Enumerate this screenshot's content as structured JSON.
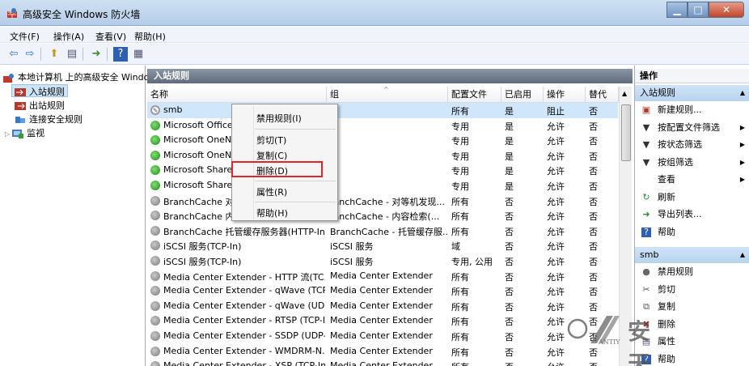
{
  "window": {
    "title": "高级安全 Windows 防火墙"
  },
  "menu": [
    "文件(F)",
    "操作(A)",
    "查看(V)",
    "帮助(H)"
  ],
  "tree": {
    "root": "本地计算机 上的高级安全 Windo",
    "items": [
      "入站规则",
      "出站规则",
      "连接安全规则",
      "监视"
    ]
  },
  "center": {
    "title": "入站规则",
    "columns": [
      "名称",
      "组",
      "配置文件",
      "已启用",
      "操作",
      "替代"
    ],
    "rows": [
      {
        "icon": "block",
        "name": "smb",
        "group": "",
        "profile": "所有",
        "enabled": "是",
        "action": "阻止",
        "override": "否"
      },
      {
        "icon": "green",
        "name": "Microsoft Office",
        "group": "",
        "profile": "专用",
        "enabled": "是",
        "action": "允许",
        "override": "否"
      },
      {
        "icon": "green",
        "name": "Microsoft OneN",
        "group": "",
        "profile": "专用",
        "enabled": "是",
        "action": "允许",
        "override": "否"
      },
      {
        "icon": "green",
        "name": "Microsoft OneN",
        "group": "",
        "profile": "专用",
        "enabled": "是",
        "action": "允许",
        "override": "否"
      },
      {
        "icon": "green",
        "name": "Microsoft Share",
        "group": "",
        "profile": "专用",
        "enabled": "是",
        "action": "允许",
        "override": "否"
      },
      {
        "icon": "green",
        "name": "Microsoft Share",
        "group": "",
        "profile": "专用",
        "enabled": "是",
        "action": "允许",
        "override": "否"
      },
      {
        "icon": "gray",
        "name": "BranchCache 对等",
        "group": "ranchCache - 对等机发现...",
        "profile": "所有",
        "enabled": "否",
        "action": "允许",
        "override": "否"
      },
      {
        "icon": "gray",
        "name": "BranchCache 内容",
        "group": "ranchCache - 内容检索(...",
        "profile": "所有",
        "enabled": "否",
        "action": "允许",
        "override": "否"
      },
      {
        "icon": "gray",
        "name": "BranchCache 托管缓存服务器(HTTP-In)",
        "group": "BranchCache - 托管缓存服...",
        "profile": "所有",
        "enabled": "否",
        "action": "允许",
        "override": "否"
      },
      {
        "icon": "gray",
        "name": "iSCSI 服务(TCP-In)",
        "group": "iSCSI 服务",
        "profile": "域",
        "enabled": "否",
        "action": "允许",
        "override": "否"
      },
      {
        "icon": "gray",
        "name": "iSCSI 服务(TCP-In)",
        "group": "iSCSI 服务",
        "profile": "专用, 公用",
        "enabled": "否",
        "action": "允许",
        "override": "否"
      },
      {
        "icon": "gray",
        "name": "Media Center Extender - HTTP 流(TC...",
        "group": "Media Center Extender",
        "profile": "所有",
        "enabled": "否",
        "action": "允许",
        "override": "否"
      },
      {
        "icon": "gray",
        "name": "Media Center Extender - qWave (TCP...",
        "group": "Media Center Extender",
        "profile": "所有",
        "enabled": "否",
        "action": "允许",
        "override": "否"
      },
      {
        "icon": "gray",
        "name": "Media Center Extender - qWave (UD...",
        "group": "Media Center Extender",
        "profile": "所有",
        "enabled": "否",
        "action": "允许",
        "override": "否"
      },
      {
        "icon": "gray",
        "name": "Media Center Extender - RTSP (TCP-In)",
        "group": "Media Center Extender",
        "profile": "所有",
        "enabled": "否",
        "action": "允许",
        "override": "否"
      },
      {
        "icon": "gray",
        "name": "Media Center Extender - SSDP (UDP-...",
        "group": "Media Center Extender",
        "profile": "所有",
        "enabled": "否",
        "action": "允许",
        "override": "否"
      },
      {
        "icon": "gray",
        "name": "Media Center Extender - WMDRM-N...",
        "group": "Media Center Extender",
        "profile": "所有",
        "enabled": "否",
        "action": "允许",
        "override": "否"
      },
      {
        "icon": "gray",
        "name": "Media Center Extender - XSP (TCP-In)",
        "group": "Media Center Extender",
        "profile": "所有",
        "enabled": "否",
        "action": "允许",
        "override": "否"
      }
    ]
  },
  "context_menu": {
    "items": [
      "禁用规则(I)",
      "剪切(T)",
      "复制(C)",
      "删除(D)",
      "属性(R)",
      "帮助(H)"
    ],
    "highlighted": "删除(D)"
  },
  "actions": {
    "title": "操作",
    "section1": "入站规则",
    "section1_items": [
      {
        "icon": "new-rule-icon",
        "label": "新建规则..."
      },
      {
        "icon": "filter-icon",
        "label": "按配置文件筛选",
        "submenu": true
      },
      {
        "icon": "filter-icon",
        "label": "按状态筛选",
        "submenu": true
      },
      {
        "icon": "filter-icon",
        "label": "按组筛选",
        "submenu": true
      },
      {
        "icon": "",
        "label": "查看",
        "submenu": true
      },
      {
        "icon": "refresh-icon",
        "label": "刷新"
      },
      {
        "icon": "export-icon",
        "label": "导出列表..."
      },
      {
        "icon": "help-icon",
        "label": "帮助"
      }
    ],
    "section2": "smb",
    "section2_items": [
      {
        "icon": "disable-icon",
        "label": "禁用规则"
      },
      {
        "icon": "cut-icon",
        "label": "剪切"
      },
      {
        "icon": "copy-icon",
        "label": "复制"
      },
      {
        "icon": "delete-icon",
        "label": "删除"
      },
      {
        "icon": "properties-icon",
        "label": "属性"
      },
      {
        "icon": "help-icon",
        "label": "帮助"
      }
    ]
  },
  "watermark": {
    "main": "安天",
    "small": "ANTIY"
  }
}
